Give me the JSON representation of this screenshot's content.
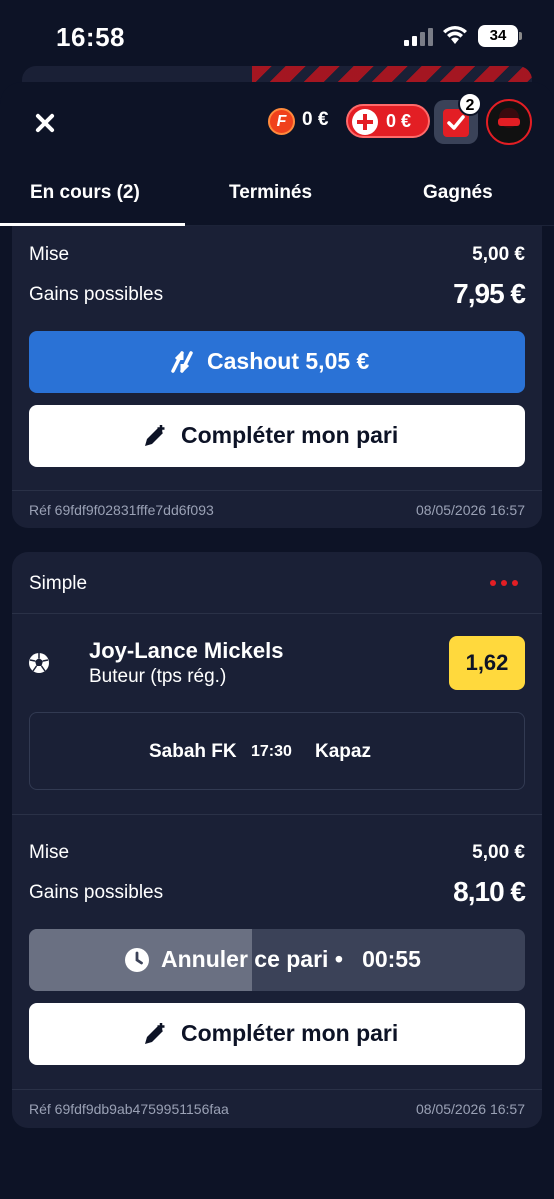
{
  "status": {
    "time": "16:58",
    "battery": "34"
  },
  "header": {
    "fc_value": "0 €",
    "plus_value": "0 €",
    "slip_count": "2",
    "fc_letter": "F"
  },
  "tabs": [
    {
      "label": "En cours (2)",
      "active": true
    },
    {
      "label": "Terminés",
      "active": false
    },
    {
      "label": "Gagnés",
      "active": false
    }
  ],
  "bet1": {
    "stake_label": "Mise",
    "stake_value": "5,00 €",
    "gains_label": "Gains possibles",
    "gains_value": "7,95 €",
    "cashout_label": "Cashout 5,05 €",
    "complete_label": "Compléter mon pari",
    "ref": "Réf 69fdf9f02831fffe7dd6f093",
    "date": "08/05/2026 16:57"
  },
  "bet2": {
    "type": "Simple",
    "player": "Joy-Lance Mickels",
    "market": "Buteur (tps rég.)",
    "odds": "1,62",
    "home": "Sabah FK",
    "time": "17:30",
    "away": "Kapaz",
    "stake_label": "Mise",
    "stake_value": "5,00 €",
    "gains_label": "Gains possibles",
    "gains_value": "8,10 €",
    "cancel_label": "Annuler ce pari •",
    "cancel_timer": "00:55",
    "cancel_progress": 0.45,
    "complete_label": "Compléter mon pari",
    "ref": "Réf 69fdf9db9ab4759951156faa",
    "date": "08/05/2026 16:57"
  },
  "colors": {
    "accent_red": "#e31e24",
    "cashout_blue": "#2a72d6",
    "odds_yellow": "#ffd93d",
    "card_bg": "#1a2036",
    "page_bg": "#0d1326"
  }
}
